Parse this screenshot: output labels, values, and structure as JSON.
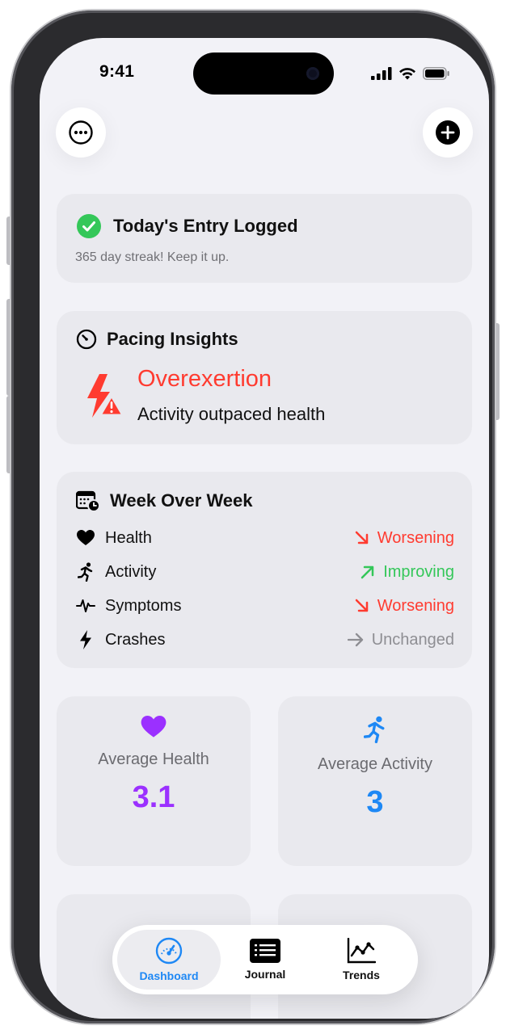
{
  "status_bar": {
    "time": "9:41"
  },
  "toolbar": {
    "more_icon": "ellipsis-circle-icon",
    "add_icon": "plus-circle-icon"
  },
  "entry_card": {
    "title": "Today's Entry Logged",
    "subtitle": "365 day streak! Keep it up.",
    "icon": "checkmark-circle-icon",
    "accent": "#34c759"
  },
  "pacing_card": {
    "title": "Pacing Insights",
    "status": "Overexertion",
    "description": "Activity outpaced health",
    "accent": "#ff3b30"
  },
  "week_card": {
    "title": "Week Over Week",
    "rows": [
      {
        "label": "Health",
        "icon": "heart-icon",
        "trend": "Worsening",
        "trend_icon": "arrow-down-right-icon",
        "color": "#ff3b30"
      },
      {
        "label": "Activity",
        "icon": "figure-run-icon",
        "trend": "Improving",
        "trend_icon": "arrow-up-right-icon",
        "color": "#34c759"
      },
      {
        "label": "Symptoms",
        "icon": "waveform-pulse-icon",
        "trend": "Worsening",
        "trend_icon": "arrow-down-right-icon",
        "color": "#ff3b30"
      },
      {
        "label": "Crashes",
        "icon": "bolt-icon",
        "trend": "Unchanged",
        "trend_icon": "arrow-right-icon",
        "color": "#8e8e93"
      }
    ]
  },
  "stats": {
    "health": {
      "label": "Average Health",
      "value": "3.1",
      "color": "#9b30ff",
      "icon": "heart-icon"
    },
    "activity": {
      "label": "Average Activity",
      "value": "3",
      "color": "#1e88f5",
      "icon": "figure-run-icon"
    }
  },
  "tab_bar": {
    "tabs": [
      {
        "label": "Dashboard",
        "icon": "gauge-icon",
        "active": true
      },
      {
        "label": "Journal",
        "icon": "list-document-icon",
        "active": false
      },
      {
        "label": "Trends",
        "icon": "chart-line-icon",
        "active": false
      }
    ]
  }
}
